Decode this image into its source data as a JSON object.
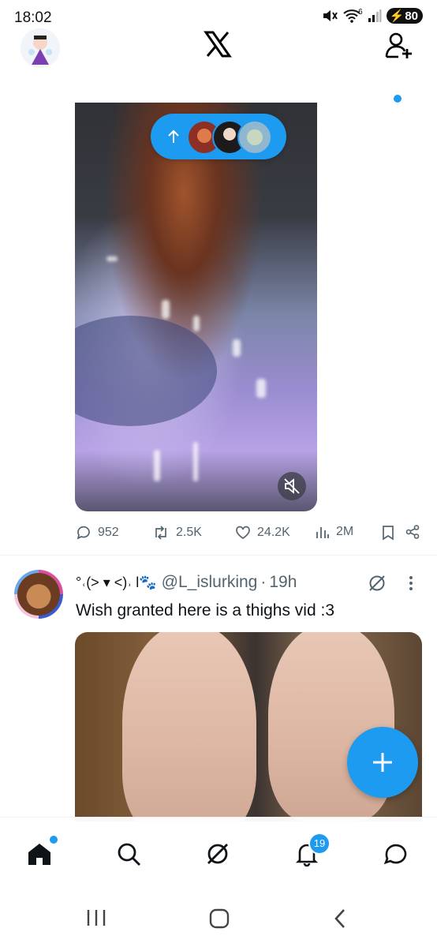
{
  "status_bar": {
    "time": "18:02",
    "battery": "80",
    "network": "6"
  },
  "header": {
    "logo_icon": "x-logo-icon",
    "follow_icon": "add-person-icon"
  },
  "new_posts_pill": {
    "icon": "arrow-up-icon"
  },
  "post_1": {
    "actions": {
      "replies": "952",
      "reposts": "2.5K",
      "likes": "24.2K",
      "views": "2M"
    }
  },
  "post_2": {
    "display_name": "°˓(˃ ▾ ˂)˒ l🐾",
    "handle": "@L_islurking",
    "separator": "·",
    "time": "19h",
    "text": "Wish granted here is a thighs vid :3"
  },
  "bottom_nav": {
    "notifications_badge": "19"
  },
  "colors": {
    "accent": "#1d9bf0",
    "muted": "#536471",
    "text": "#0f1419"
  }
}
